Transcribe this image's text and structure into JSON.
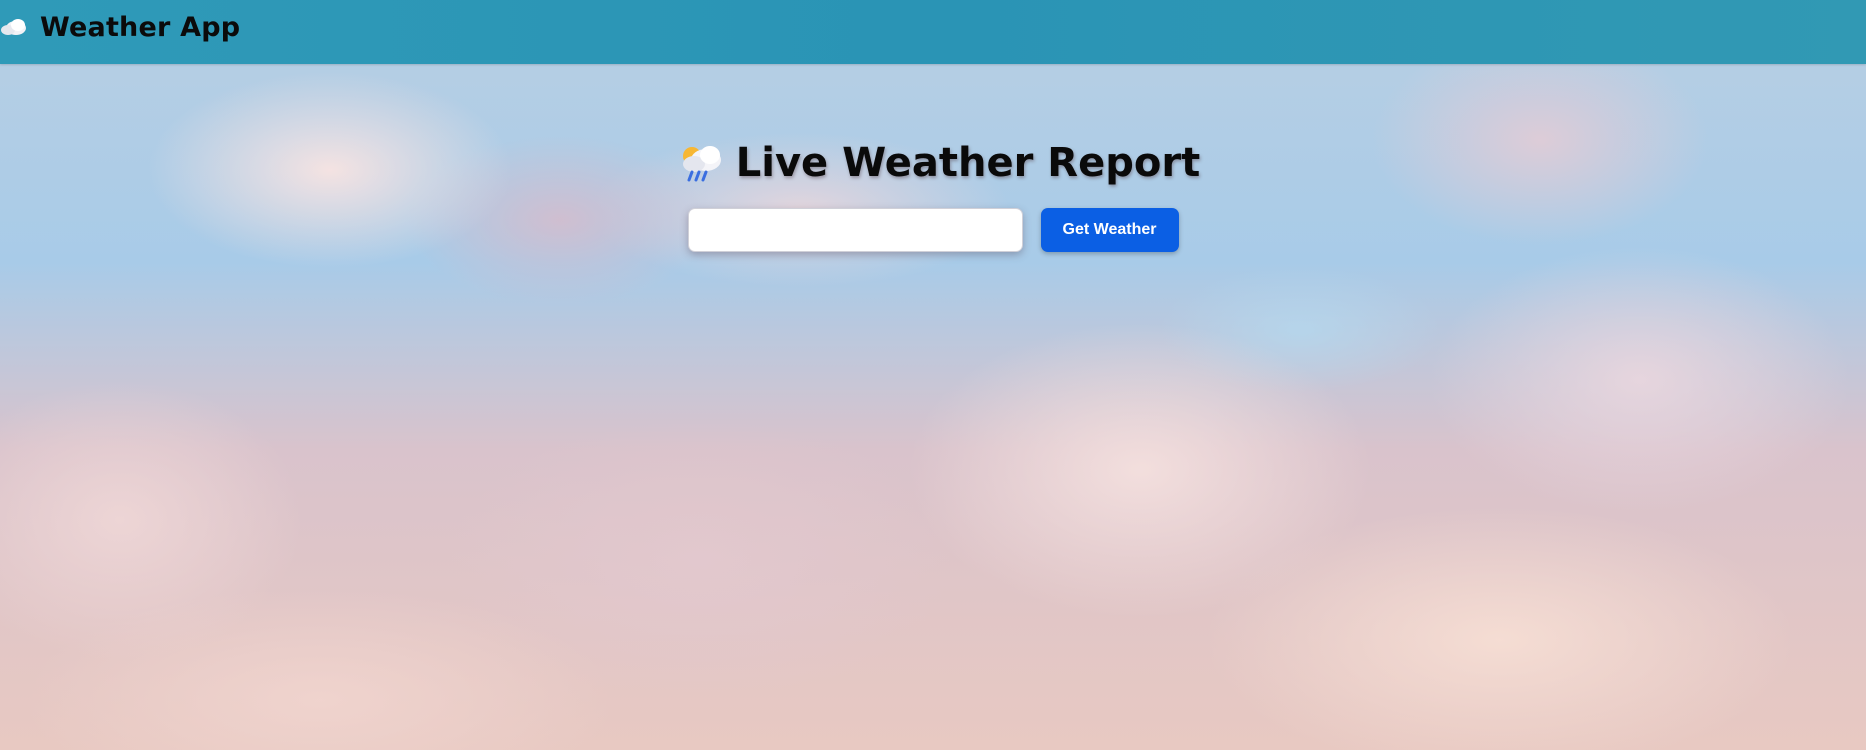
{
  "navbar": {
    "brand_icon": "cloud-icon",
    "title": "Weather App",
    "background_color": "#2f9ab8"
  },
  "hero": {
    "icon": "cloud-rain-icon",
    "title": "Live Weather Report"
  },
  "search": {
    "value": "",
    "placeholder": "",
    "button_label": "Get Weather",
    "button_color": "#0b5fe4"
  }
}
